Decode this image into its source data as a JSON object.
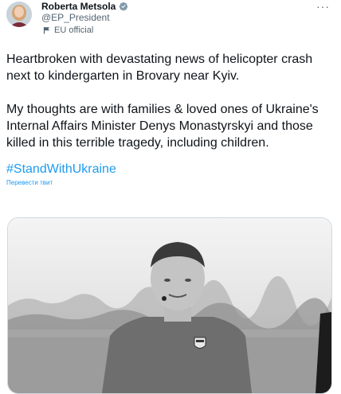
{
  "author": {
    "name": "Roberta Metsola",
    "handle": "@EP_President",
    "verified_icon": "verified-badge-icon",
    "official_label": "EU official"
  },
  "tweet": {
    "paragraph1": "Heartbroken with devastating news of helicopter crash next to kindergarten in Brovary near Kyiv.",
    "paragraph2": "My thoughts are with families & loved ones of Ukraine's Internal Affairs Minister Denys Monastyrskyi and those killed in this terrible tragedy, including children.",
    "hashtag": "#StandWithUkraine",
    "translate_link": "Перевести твит"
  },
  "menu": {
    "more_label": "···"
  },
  "colors": {
    "link": "#1d9bf0",
    "text": "#0f1419",
    "muted": "#536471"
  }
}
